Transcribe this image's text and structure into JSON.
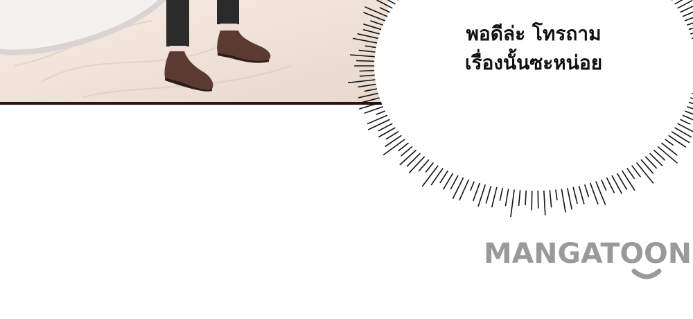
{
  "speech_bubble": {
    "lines": [
      "พอดีล่ะ โทรถาม",
      "เรื่องนั้นซะหน่อย"
    ]
  },
  "watermark": {
    "text": "MANGATOON",
    "color": "#9a9a9a"
  },
  "colors": {
    "floor": "#efe3da",
    "panel_border": "#2a1414",
    "shoe": "#5a3a31",
    "trousers": "#2b2b2b",
    "sock": "#f0dcd6"
  }
}
